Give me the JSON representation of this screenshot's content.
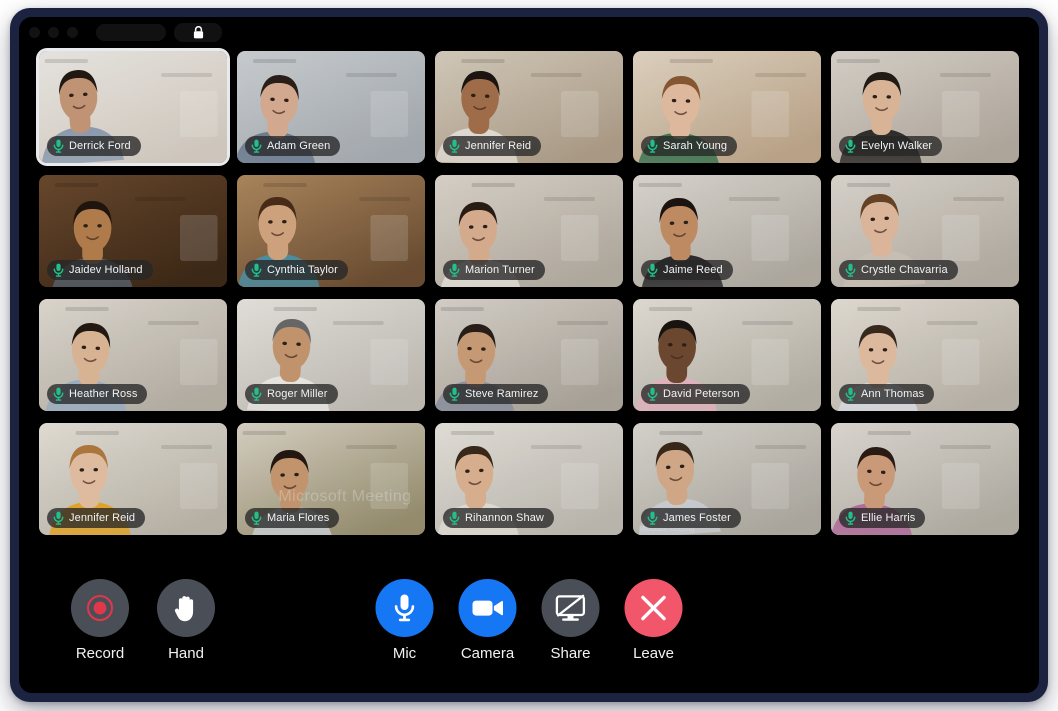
{
  "window": {
    "titlebar": {
      "traffic_lights": [
        "close",
        "minimize",
        "maximize"
      ],
      "address_pill": "",
      "lock_icon": "lock-icon"
    }
  },
  "meeting": {
    "watermark": "Microsoft Meeting",
    "watermark_small": "Microsoft Meeting",
    "participants": [
      {
        "name": "Derrick Ford",
        "mic_icon": "microphone-icon",
        "active_speaker": true,
        "skin": "#c89a7a",
        "bg1": "#efece7",
        "bg2": "#d7cfc5",
        "shirt": "#8fa0b4",
        "hair": "#241a14"
      },
      {
        "name": "Adam Green",
        "mic_icon": "microphone-icon",
        "active_speaker": false,
        "skin": "#dbb094",
        "bg1": "#cfd3d6",
        "bg2": "#a8aeb4",
        "shirt": "#6f8196",
        "hair": "#2b2119"
      },
      {
        "name": "Jennifer Reid",
        "mic_icon": "microphone-icon",
        "active_speaker": false,
        "skin": "#a5714d",
        "bg1": "#d9cfc0",
        "bg2": "#b0a08a",
        "shirt": "#e8e3db",
        "hair": "#1d1512"
      },
      {
        "name": "Sarah Young",
        "mic_icon": "microphone-icon",
        "active_speaker": false,
        "skin": "#e6c0a4",
        "bg1": "#e4d8c6",
        "bg2": "#c0a88c",
        "shirt": "#3f7a55",
        "hair": "#8a5a33"
      },
      {
        "name": "Evelyn Walker",
        "mic_icon": "microphone-icon",
        "active_speaker": false,
        "skin": "#e2bb9c",
        "bg1": "#dcd6cd",
        "bg2": "#b5aca1",
        "shirt": "#2e2c2a",
        "hair": "#241c16"
      },
      {
        "name": "Jaidev Holland",
        "mic_icon": "microphone-icon",
        "active_speaker": false,
        "skin": "#b8814f",
        "bg1": "#6b4a2e",
        "bg2": "#3f2a18",
        "shirt": "#59636e",
        "hair": "#20160f"
      },
      {
        "name": "Cynthia Taylor",
        "mic_icon": "microphone-icon",
        "active_speaker": false,
        "skin": "#d6a882",
        "bg1": "#b08a60",
        "bg2": "#6d4f33",
        "shirt": "#4f93a8",
        "hair": "#4a2d18"
      },
      {
        "name": "Marion Turner",
        "mic_icon": "microphone-icon",
        "active_speaker": false,
        "skin": "#dcb192",
        "bg1": "#ded7cd",
        "bg2": "#b6aea3",
        "shirt": "#e9e4dc",
        "hair": "#2a1d14"
      },
      {
        "name": "Jaime Reed",
        "mic_icon": "microphone-icon",
        "active_speaker": false,
        "skin": "#c69066",
        "bg1": "#dfdbd4",
        "bg2": "#b3ada4",
        "shirt": "#2b2a2c",
        "hair": "#1c1410"
      },
      {
        "name": "Crystle Chavarria",
        "mic_icon": "microphone-icon",
        "active_speaker": false,
        "skin": "#e4bda0",
        "bg1": "#ded9d1",
        "bg2": "#b7b0a6",
        "shirt": "#cfc6ba",
        "hair": "#6a4527"
      },
      {
        "name": "Heather Ross",
        "mic_icon": "microphone-icon",
        "active_speaker": false,
        "skin": "#e0bb9b",
        "bg1": "#e2ddd4",
        "bg2": "#b9b2a7",
        "shirt": "#9fb4c8",
        "hair": "#231a13"
      },
      {
        "name": "Roger Miller",
        "mic_icon": "microphone-icon",
        "active_speaker": false,
        "skin": "#c89a72",
        "bg1": "#e9e6e1",
        "bg2": "#c3bfb7",
        "shirt": "#f0eee9",
        "hair": "#6b6b6b"
      },
      {
        "name": "Steve Ramirez",
        "mic_icon": "microphone-icon",
        "active_speaker": false,
        "skin": "#cfa07a",
        "bg1": "#dad5cd",
        "bg2": "#aea79d",
        "shirt": "#8d93a2",
        "hair": "#2a2018"
      },
      {
        "name": "David Peterson",
        "mic_icon": "microphone-icon",
        "active_speaker": false,
        "skin": "#6f4a30",
        "bg1": "#e5e1d9",
        "bg2": "#b9b4a9",
        "shirt": "#e8b9c4",
        "hair": "#1b1410"
      },
      {
        "name": "Ann Thomas",
        "mic_icon": "microphone-icon",
        "active_speaker": false,
        "skin": "#e5c0a4",
        "bg1": "#e6e1d8",
        "bg2": "#bdb6ab",
        "shirt": "#dfe3e8",
        "hair": "#3a2a1e"
      },
      {
        "name": "Jennifer Reid",
        "mic_icon": "microphone-icon",
        "active_speaker": false,
        "skin": "#e8c3a6",
        "bg1": "#e7e3da",
        "bg2": "#beb7ab",
        "shirt": "#e8a92a",
        "hair": "#b27a3f"
      },
      {
        "name": "Maria Flores",
        "mic_icon": "microphone-icon",
        "active_speaker": false,
        "skin": "#c99b72",
        "bg1": "#ddd6c8",
        "bg2": "#9a9171",
        "shirt": "#cfd4d8",
        "hair": "#241a12"
      },
      {
        "name": "Rihannon Shaw",
        "mic_icon": "microphone-icon",
        "active_speaker": false,
        "skin": "#dfb593",
        "bg1": "#e8e5de",
        "bg2": "#c0bcb3",
        "shirt": "#e6e2da",
        "hair": "#3b2a1c"
      },
      {
        "name": "James Foster",
        "mic_icon": "microphone-icon",
        "active_speaker": false,
        "skin": "#d9ae8c",
        "bg1": "#dcd9d2",
        "bg2": "#b0aca3",
        "shirt": "#cfd3d8",
        "hair": "#3a2a1c"
      },
      {
        "name": "Ellie Harris",
        "mic_icon": "microphone-icon",
        "active_speaker": false,
        "skin": "#d3a07c",
        "bg1": "#e1ddd6",
        "bg2": "#b5b0a6",
        "shirt": "#b86fa0",
        "hair": "#2b1d14"
      }
    ]
  },
  "controls": {
    "left": [
      {
        "label": "Record",
        "icon": "record-icon",
        "style": "gray"
      },
      {
        "label": "Hand",
        "icon": "raise-hand-icon",
        "style": "gray"
      }
    ],
    "center": [
      {
        "label": "Mic",
        "icon": "microphone-icon",
        "style": "blue"
      },
      {
        "label": "Camera",
        "icon": "video-camera-icon",
        "style": "blue"
      },
      {
        "label": "Share",
        "icon": "screen-share-off-icon",
        "style": "gray"
      },
      {
        "label": "Leave",
        "icon": "close-x-icon",
        "style": "red"
      }
    ]
  },
  "colors": {
    "accent_blue": "#1677f5",
    "leave_red": "#f2566a",
    "control_gray": "#4a4f57",
    "mic_green": "#21c08b",
    "frame_navy": "#1b2340",
    "stage_black": "#000000",
    "record_red": "#e0384a"
  }
}
